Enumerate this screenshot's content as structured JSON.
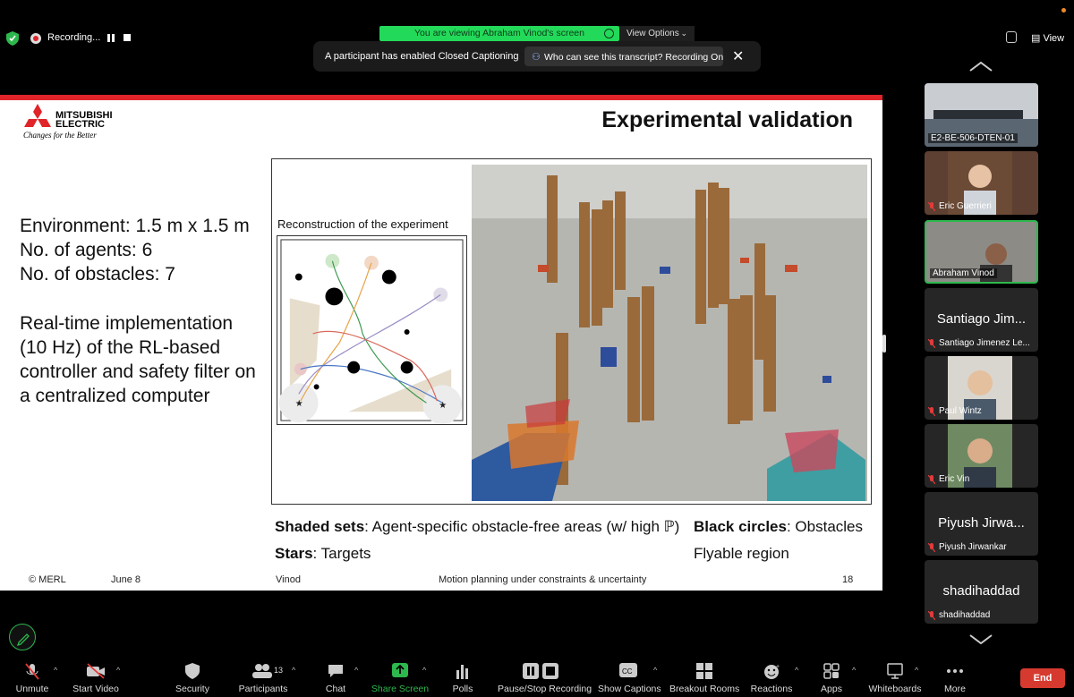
{
  "top": {
    "recording_label": "Recording...",
    "viewing_banner": "You are viewing Abraham Vinod's screen",
    "view_options": "View Options",
    "cc_notice": "A participant has enabled Closed Captioning",
    "cc_pill": "Who can see this transcript? Recording On",
    "view_button": "View"
  },
  "slide": {
    "logo_line1": "MITSUBISHI",
    "logo_line2": "ELECTRIC",
    "logo_tagline": "Changes for the Better",
    "title": "Experimental validation",
    "left_lines": [
      "Environment: 1.5 m x 1.5 m",
      "No. of agents: 6",
      "No. of obstacles: 7"
    ],
    "left_para": [
      "Real-time implementation",
      "(10 Hz) of the RL-based",
      "controller and safety filter on",
      "a centralized computer"
    ],
    "recon_label": "Reconstruction of the experiment",
    "shaded_bold": "Shaded sets",
    "shaded_rest": ": Agent-specific obstacle-free areas (w/ high ℙ)",
    "black_bold": "Black circles",
    "black_rest": ": Obstacles",
    "stars_bold": "Stars",
    "stars_rest": ": Targets",
    "flyable": "Flyable region",
    "footer_copy": "© MERL",
    "footer_date": "June 8",
    "footer_author": "Vinod",
    "footer_title": "Motion planning under constraints & uncertainty",
    "footer_page": "18"
  },
  "participants": [
    {
      "name": "E2-BE-506-DTEN-01",
      "type": "video",
      "muted": false
    },
    {
      "name": "Eric Guerrieri",
      "type": "video",
      "muted": true
    },
    {
      "name": "Abraham Vinod",
      "type": "video",
      "muted": false,
      "active": true
    },
    {
      "name": "Santiago Jimenez Le...",
      "display": "Santiago Jim...",
      "type": "name",
      "muted": true
    },
    {
      "name": "Paul Wintz",
      "type": "video",
      "muted": true
    },
    {
      "name": "Eric Vin",
      "type": "video",
      "muted": true
    },
    {
      "name": "Piyush Jirwankar",
      "display": "Piyush Jirwa...",
      "type": "name",
      "muted": true
    },
    {
      "name": "shadihaddad",
      "display": "shadihaddad",
      "type": "name",
      "muted": true
    }
  ],
  "toolbar": {
    "unmute": "Unmute",
    "start_video": "Start Video",
    "security": "Security",
    "participants": "Participants",
    "participants_count": "13",
    "chat": "Chat",
    "share_screen": "Share Screen",
    "polls": "Polls",
    "pause_stop_recording": "Pause/Stop Recording",
    "show_captions": "Show Captions",
    "breakout_rooms": "Breakout Rooms",
    "reactions": "Reactions",
    "apps": "Apps",
    "whiteboards": "Whiteboards",
    "more": "More",
    "end": "End"
  },
  "colors": {
    "banner_green": "#23d959",
    "active_border": "#2db84d",
    "end_red": "#d63a2f",
    "slide_red": "#e0242a"
  }
}
